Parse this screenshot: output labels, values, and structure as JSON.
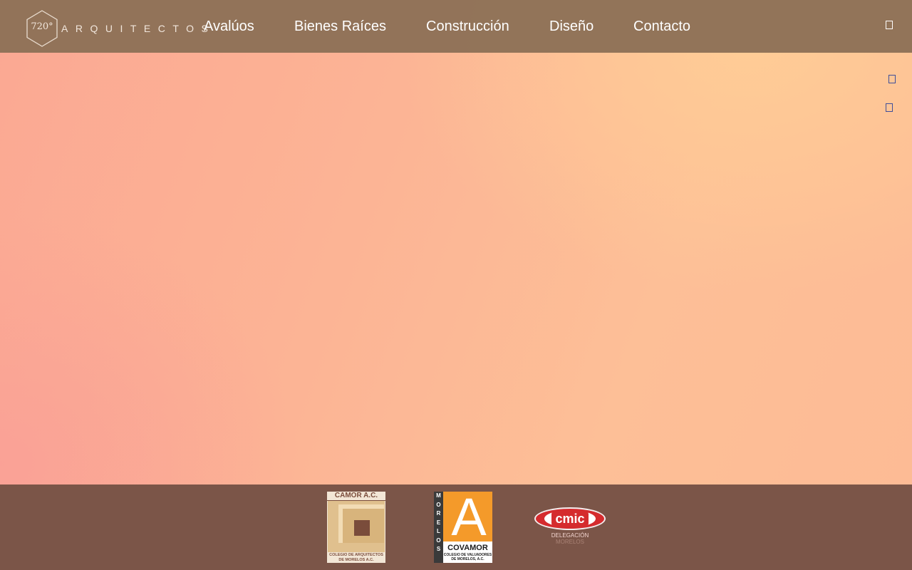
{
  "brand": {
    "logo_number": "720°",
    "wordmark": "ARQUITECTOS"
  },
  "nav": {
    "items": [
      {
        "label": "Avalúos"
      },
      {
        "label": "Bienes Raíces"
      },
      {
        "label": "Construcción"
      },
      {
        "label": "Diseño"
      },
      {
        "label": "Contacto"
      }
    ],
    "menu_icon": "menu-icon"
  },
  "side_icons": [
    "social-icon-1",
    "social-icon-2"
  ],
  "footer": {
    "logos": [
      {
        "name": "CAMOR A.C.",
        "caption_line1": "COLEGIO DE ARQUITECTOS",
        "caption_line2": "DE MORELOS A.C."
      },
      {
        "name": "COVAMOR",
        "vertical_text": [
          "M",
          "O",
          "R",
          "E",
          "L",
          "O",
          "S"
        ],
        "letter": "A",
        "caption_line1": "COLEGIO DE VALUADORES",
        "caption_line2": "DE MORELOS, A.C."
      },
      {
        "name": "cmic",
        "sub_line1": "DELEGACIÓN",
        "sub_line2": "MORELOS"
      }
    ]
  },
  "colors": {
    "navbar": "#8e7056",
    "footer": "#7b5548",
    "hero_gradient_start": "#fba893",
    "hero_gradient_end": "#fdbf97"
  }
}
